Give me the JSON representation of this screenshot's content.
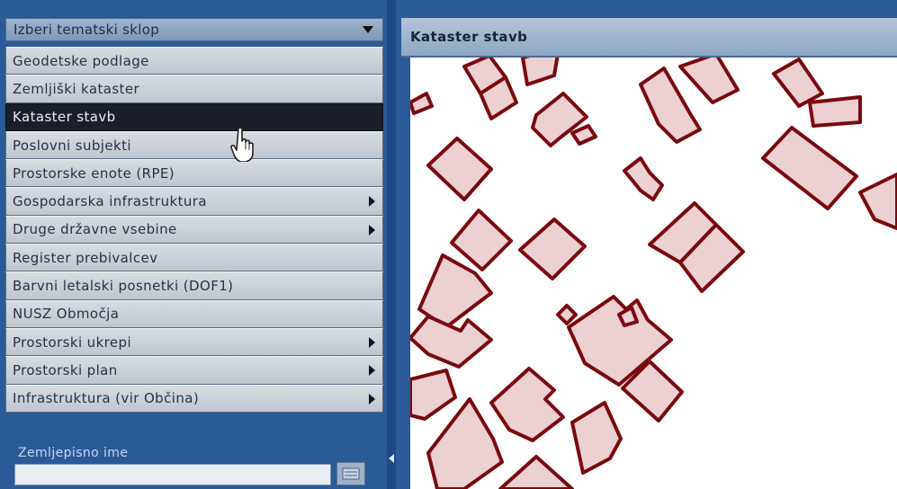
{
  "dropdown": {
    "label": "Izberi tematski sklop"
  },
  "menu": [
    {
      "label": "Geodetske podlage",
      "submenu": false,
      "selected": false
    },
    {
      "label": "Zemljiški kataster",
      "submenu": false,
      "selected": false
    },
    {
      "label": "Kataster stavb",
      "submenu": false,
      "selected": true
    },
    {
      "label": "Poslovni subjekti",
      "submenu": false,
      "selected": false
    },
    {
      "label": "Prostorske enote (RPE)",
      "submenu": false,
      "selected": false
    },
    {
      "label": "Gospodarska infrastruktura",
      "submenu": true,
      "selected": false
    },
    {
      "label": "Druge državne vsebine",
      "submenu": true,
      "selected": false
    },
    {
      "label": "Register prebivalcev",
      "submenu": false,
      "selected": false
    },
    {
      "label": "Barvni letalski posnetki (DOF1)",
      "submenu": false,
      "selected": false
    },
    {
      "label": "NUSZ Območja",
      "submenu": false,
      "selected": false
    },
    {
      "label": "Prostorski ukrepi",
      "submenu": true,
      "selected": false
    },
    {
      "label": "Prostorski plan",
      "submenu": true,
      "selected": false
    },
    {
      "label": "Infrastruktura (vir Občina)",
      "submenu": true,
      "selected": false
    }
  ],
  "search": {
    "label": "Zemljepisno ime",
    "value": ""
  },
  "map": {
    "title": "Kataster stavb"
  },
  "colors": {
    "building_fill": "#ecd0d2",
    "building_outline": "#7a0a0e",
    "selected_bg": "#1b1f29"
  }
}
